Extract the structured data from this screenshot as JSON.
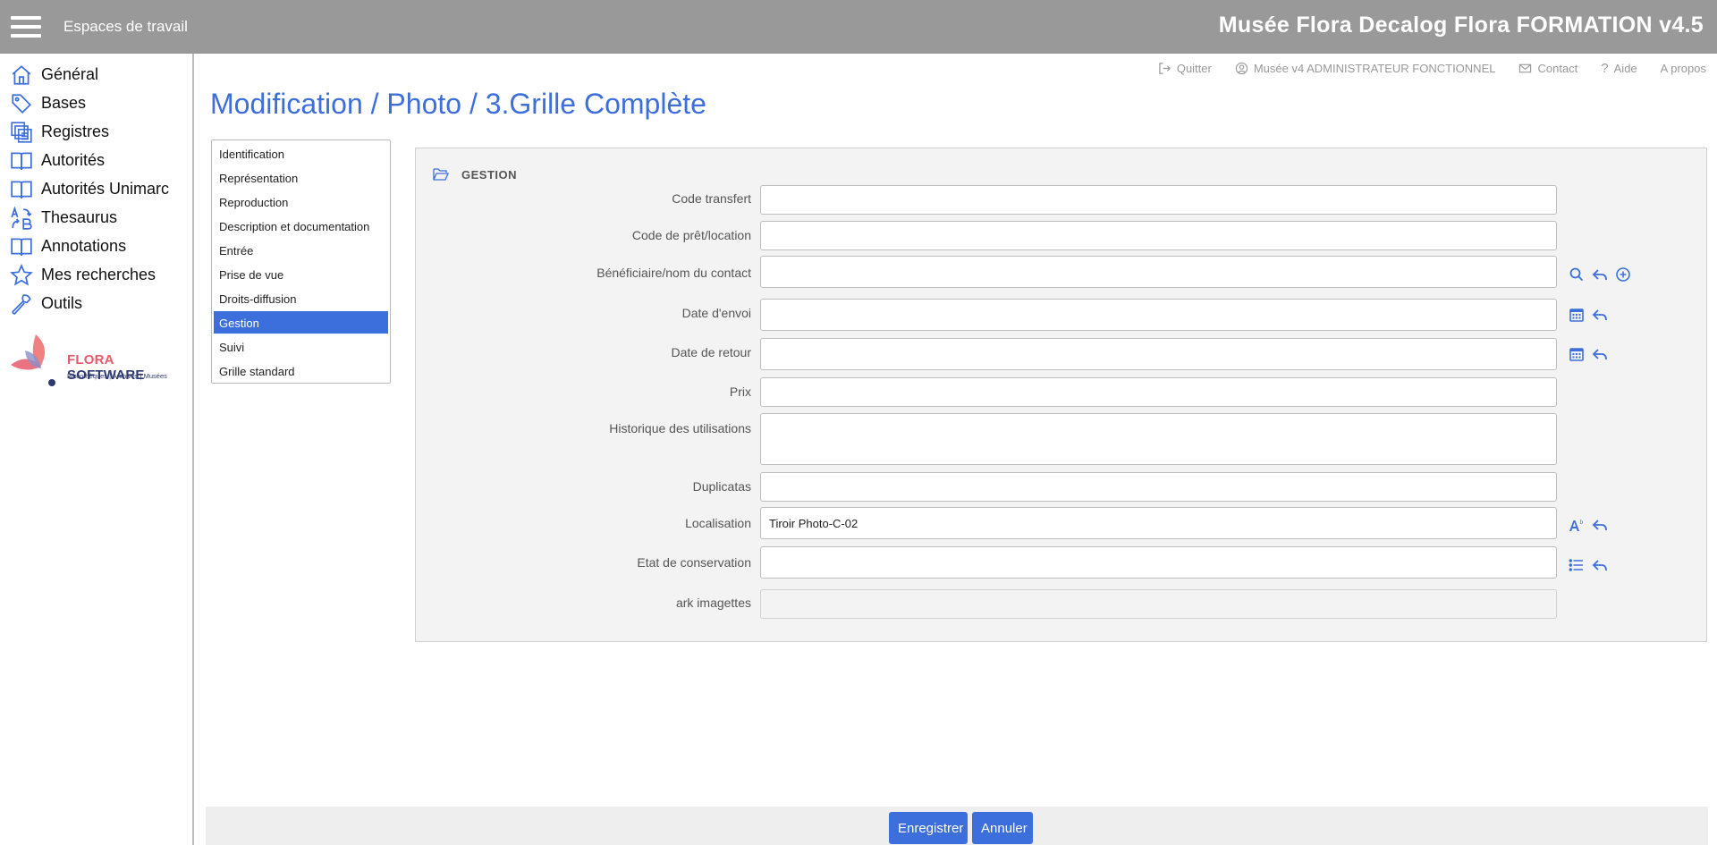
{
  "header": {
    "workspaces_label": "Espaces de travail",
    "app_title": "Musée Flora Decalog Flora FORMATION v4.5"
  },
  "sidebar": {
    "items": [
      {
        "label": "Général",
        "icon": "home-icon"
      },
      {
        "label": "Bases",
        "icon": "tag-icon"
      },
      {
        "label": "Registres",
        "icon": "registers-icon"
      },
      {
        "label": "Autorités",
        "icon": "book-icon"
      },
      {
        "label": "Autorités Unimarc",
        "icon": "book-icon"
      },
      {
        "label": "Thesaurus",
        "icon": "thesaurus-icon"
      },
      {
        "label": "Annotations",
        "icon": "book-icon"
      },
      {
        "label": "Mes recherches",
        "icon": "star-icon"
      },
      {
        "label": "Outils",
        "icon": "wrench-icon"
      }
    ],
    "logo": {
      "brand_part1": "FLORA ",
      "brand_part2": "SOFTWARE",
      "tagline": "Bibliothèques | Archives | Musées"
    }
  },
  "utils": {
    "quit": "Quitter",
    "user": "Musée v4 ADMINISTRATEUR FONCTIONNEL",
    "contact": "Contact",
    "help": "Aide",
    "about": "A propos"
  },
  "page_title": "Modification / Photo / 3.Grille Complète",
  "sections": {
    "items": [
      "Identification",
      "Représentation",
      "Reproduction",
      "Description et documentation",
      "Entrée",
      "Prise de vue",
      "Droits-diffusion",
      "Gestion",
      "Suivi",
      "Grille standard"
    ],
    "active": "Gestion"
  },
  "panel": {
    "title": "GESTION",
    "fields": [
      {
        "label": "Code transfert",
        "value": ""
      },
      {
        "label": "Code de prêt/location",
        "value": ""
      },
      {
        "label": "Bénéficiaire/nom du contact",
        "value": ""
      },
      {
        "label": "Date d'envoi",
        "value": ""
      },
      {
        "label": "Date de retour",
        "value": ""
      },
      {
        "label": "Prix",
        "value": ""
      },
      {
        "label": "Historique des utilisations",
        "value": ""
      },
      {
        "label": "Duplicatas",
        "value": ""
      },
      {
        "label": "Localisation",
        "value": "Tiroir Photo-C-02"
      },
      {
        "label": "Etat de conservation",
        "value": ""
      },
      {
        "label": "ark imagettes",
        "value": ""
      }
    ]
  },
  "buttons": {
    "save": "Enregistrer",
    "cancel": "Annuler"
  },
  "colors": {
    "accent": "#3d6fdc",
    "header_bg": "#999999",
    "logo_pink": "#e8596b",
    "logo_navy": "#2f3a72"
  }
}
